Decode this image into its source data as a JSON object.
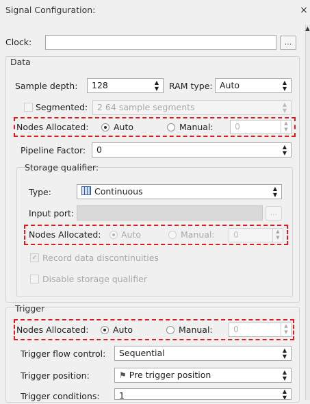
{
  "window": {
    "title": "Signal Configuration:",
    "close_glyph": "×"
  },
  "clock": {
    "label": "Clock:",
    "value": "",
    "browse_label": "..."
  },
  "data_section": {
    "title": "Data",
    "sample_depth_label": "Sample depth:",
    "sample_depth_value": "128",
    "ram_type_label": "RAM type:",
    "ram_type_value": "Auto",
    "segmented_label": "Segmented:",
    "segmented_value": "2  64 sample segments",
    "nodes_allocated_label": "Nodes Allocated:",
    "auto_label": "Auto",
    "manual_label": "Manual:",
    "manual_value": "0",
    "pipeline_label": "Pipeline Factor:",
    "pipeline_value": "0"
  },
  "storage_qualifier": {
    "title": "Storage qualifier:",
    "type_label": "Type:",
    "type_value": "Continuous",
    "input_port_label": "Input port:",
    "input_port_button": "...",
    "nodes_allocated_label": "Nodes Allocated:",
    "auto_label": "Auto",
    "manual_label": "Manual:",
    "manual_value": "0",
    "record_label": "Record data discontinuities",
    "disable_label": "Disable storage qualifier"
  },
  "trigger_section": {
    "title": "Trigger",
    "nodes_allocated_label": "Nodes Allocated:",
    "auto_label": "Auto",
    "manual_label": "Manual:",
    "manual_value": "0",
    "flow_label": "Trigger flow control:",
    "flow_value": "Sequential",
    "position_label": "Trigger position:",
    "position_value": "Pre trigger position",
    "conditions_label": "Trigger conditions:",
    "conditions_value": "1"
  },
  "colors": {
    "highlight": "#e01a1a",
    "background": "#f0f0f0"
  },
  "icons": [
    "close-icon",
    "list-icon",
    "flag-icon",
    "chevron-updown-icon",
    "spin-arrows-icon"
  ]
}
